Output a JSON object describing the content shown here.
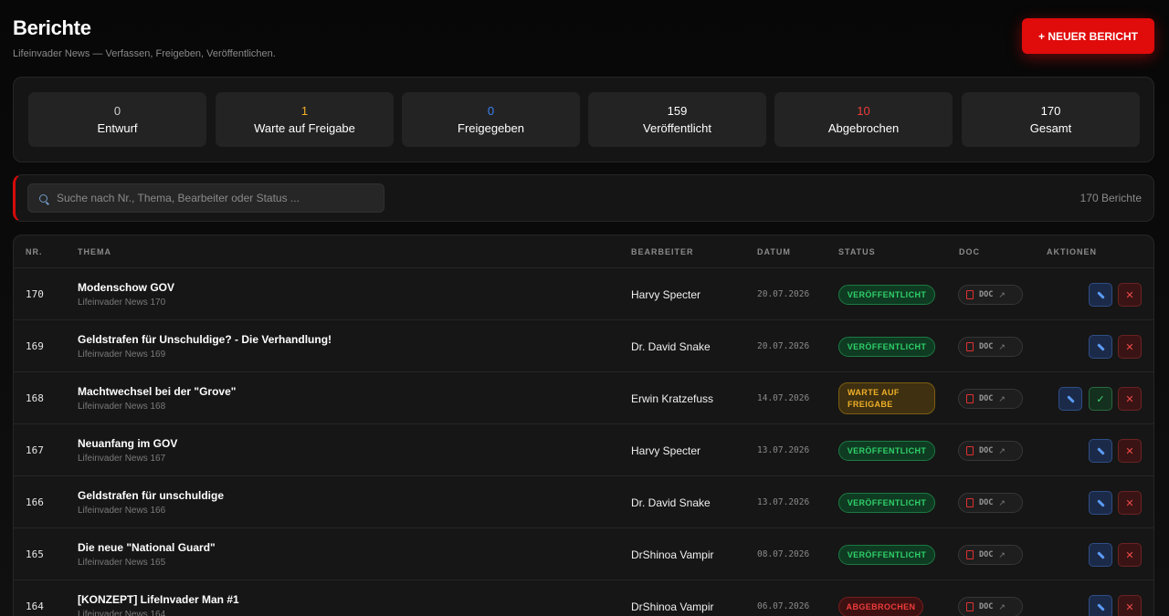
{
  "header": {
    "title": "Berichte",
    "subtitle": "Lifeinvader News — Verfassen, Freigeben, Veröffentlichen.",
    "new_button": "+ NEUER BERICHT"
  },
  "colors": {
    "accent": "#e00b0b",
    "status_published": "#2fd06a",
    "status_waiting": "#f0b028",
    "status_aborted": "#ef3b3b",
    "approved_count": "#3b82f6"
  },
  "stats": [
    {
      "value": "0",
      "label": "Entwurf",
      "color": "#cfcfcf"
    },
    {
      "value": "1",
      "label": "Warte auf Freigabe",
      "color": "#f0b028"
    },
    {
      "value": "0",
      "label": "Freigegeben",
      "color": "#3b82f6"
    },
    {
      "value": "159",
      "label": "Veröffentlicht",
      "color": "#ffffff"
    },
    {
      "value": "10",
      "label": "Abgebrochen",
      "color": "#ef3b3b"
    },
    {
      "value": "170",
      "label": "Gesamt",
      "color": "#ffffff"
    }
  ],
  "search": {
    "placeholder": "Suche nach Nr., Thema, Bearbeiter oder Status ...",
    "icon": "search-icon",
    "count": "170 Berichte"
  },
  "table": {
    "columns": [
      "NR.",
      "THEMA",
      "BEARBEITER",
      "DATUM",
      "STATUS",
      "DOC",
      "AKTIONEN"
    ],
    "doc_label": "DOC",
    "rows": [
      {
        "nr": "170",
        "title": "Modenschow GOV",
        "sub": "Lifeinvader News 170",
        "editor": "Harvy Specter",
        "date": "20.07.2026",
        "status": "VERÖFFENTLICHT",
        "status_type": "pub"
      },
      {
        "nr": "169",
        "title": "Geldstrafen für Unschuldige? - Die Verhandlung!",
        "sub": "Lifeinvader News 169",
        "editor": "Dr. David Snake",
        "date": "20.07.2026",
        "status": "VERÖFFENTLICHT",
        "status_type": "pub"
      },
      {
        "nr": "168",
        "title": "Machtwechsel bei der \"Grove\"",
        "sub": "Lifeinvader News 168",
        "editor": "Erwin Kratzefuss",
        "date": "14.07.2026",
        "status": "WARTE AUF FREIGABE",
        "status_type": "wait"
      },
      {
        "nr": "167",
        "title": "Neuanfang im GOV",
        "sub": "Lifeinvader News 167",
        "editor": "Harvy Specter",
        "date": "13.07.2026",
        "status": "VERÖFFENTLICHT",
        "status_type": "pub"
      },
      {
        "nr": "166",
        "title": "Geldstrafen für unschuldige",
        "sub": "Lifeinvader News 166",
        "editor": "Dr. David Snake",
        "date": "13.07.2026",
        "status": "VERÖFFENTLICHT",
        "status_type": "pub"
      },
      {
        "nr": "165",
        "title": "Die neue \"National Guard\"",
        "sub": "Lifeinvader News 165",
        "editor": "DrShinoa Vampir",
        "date": "08.07.2026",
        "status": "VERÖFFENTLICHT",
        "status_type": "pub"
      },
      {
        "nr": "164",
        "title": "[KONZEPT] LifeInvader Man #1",
        "sub": "Lifeinvader News 164",
        "editor": "DrShinoa Vampir",
        "date": "06.07.2026",
        "status": "ABGEBROCHEN",
        "status_type": "ab"
      }
    ]
  }
}
